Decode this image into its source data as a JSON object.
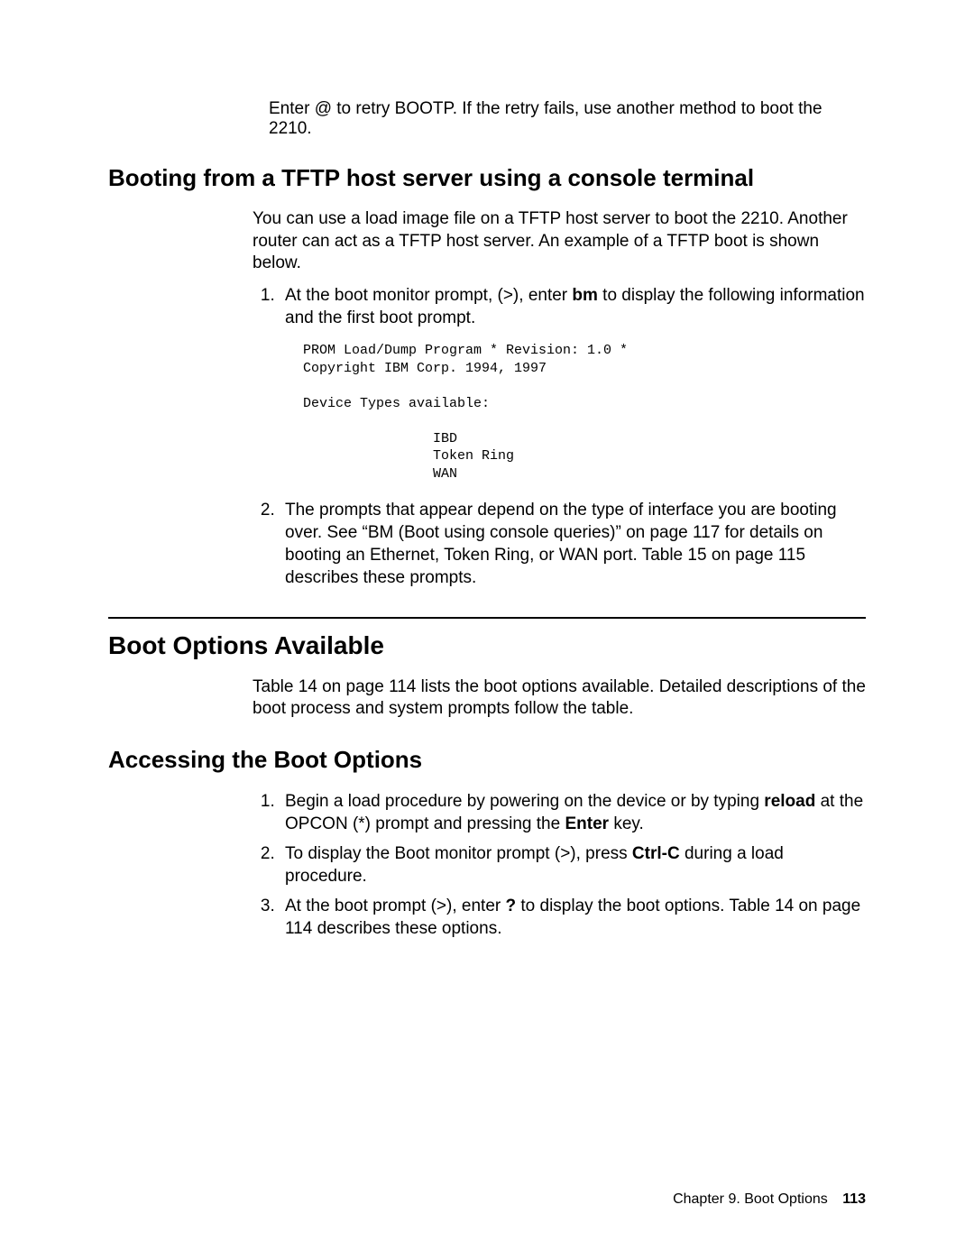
{
  "intro": "Enter @ to retry BOOTP. If the retry fails, use another method to boot the 2210.",
  "sec1": {
    "title": "Booting from a TFTP host server using a console terminal",
    "para": "You can use a load image file on a TFTP host server to boot the 2210. Another router can act as a TFTP host server. An example of a TFTP boot is shown below.",
    "li1a": "At the boot monitor prompt, (>), enter ",
    "li1b": "bm",
    "li1c": " to display the following information and the first boot prompt.",
    "code": "PROM Load/Dump Program * Revision: 1.0 *\nCopyright IBM Corp. 1994, 1997\n\nDevice Types available:\n\n                IBD\n                Token Ring\n                WAN",
    "li2": "The prompts that appear depend on the type of interface you are booting over. See “BM (Boot using console queries)” on page 117 for details on booting an Ethernet, Token Ring, or WAN port. Table 15 on page 115 describes these prompts."
  },
  "sec2": {
    "title": "Boot Options Available",
    "para": "Table 14 on page 114 lists the boot options available. Detailed descriptions of the boot process and system prompts follow the table."
  },
  "sec3": {
    "title": "Accessing the Boot Options",
    "li1a": "Begin a load procedure by powering on the device or by typing ",
    "li1b": "reload",
    "li1c": " at the OPCON (*) prompt and pressing the ",
    "li1d": "Enter",
    "li1e": " key.",
    "li2a": "To display the Boot monitor prompt (>), press ",
    "li2b": "Ctrl-C",
    "li2c": " during a load procedure.",
    "li3a": "At the boot prompt (>), enter ",
    "li3b": "?",
    "li3c": " to display the boot options. Table 14 on page 114  describes these options."
  },
  "footer": {
    "chapter": "Chapter 9. Boot Options",
    "page": "113"
  }
}
